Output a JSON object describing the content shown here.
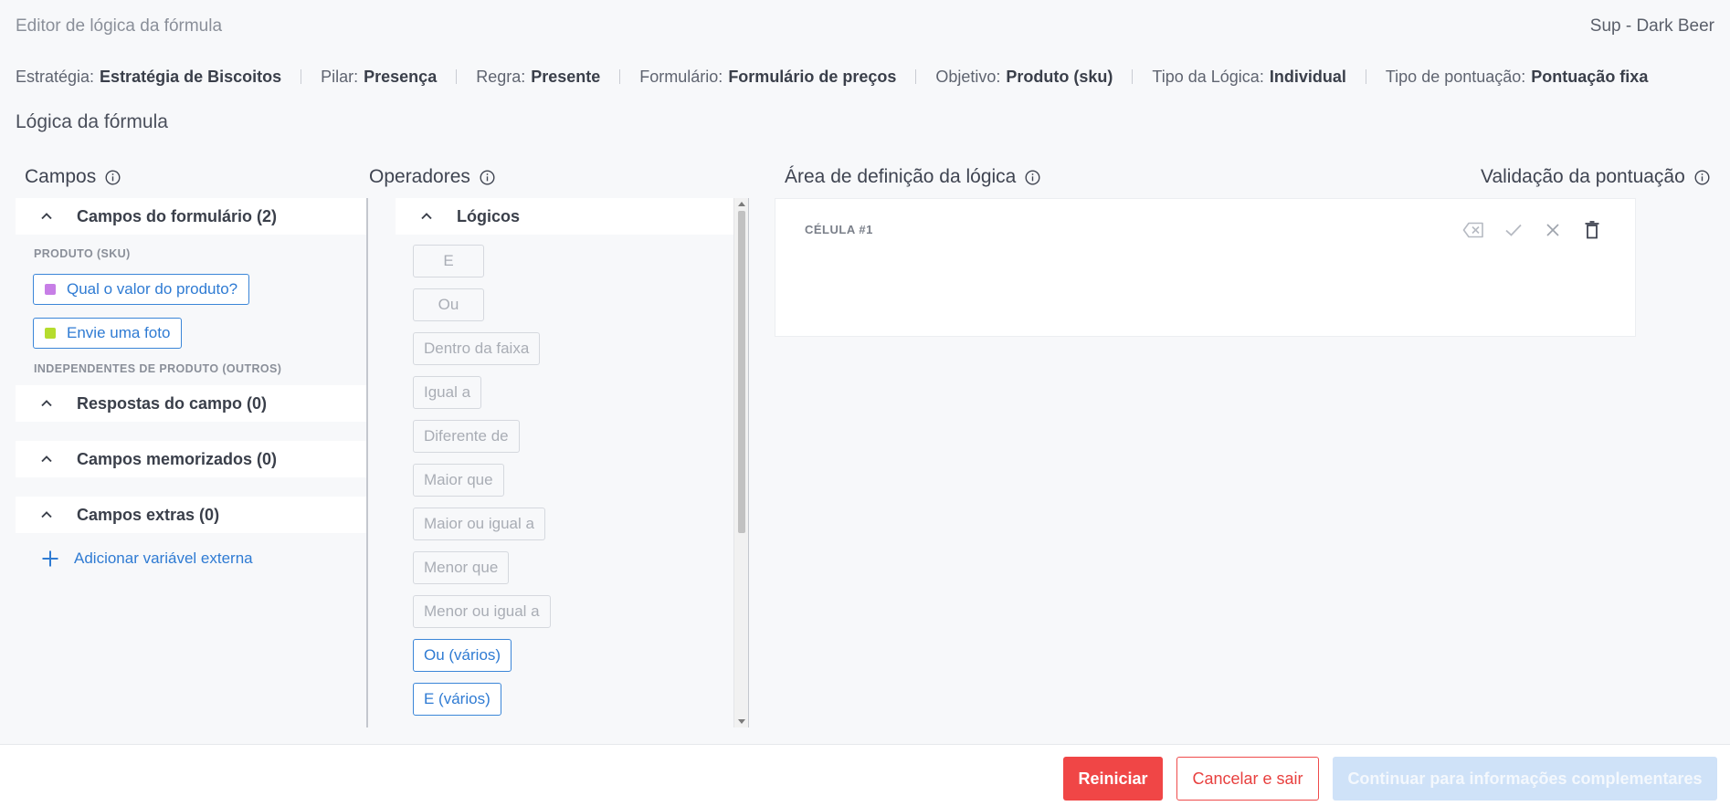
{
  "header": {
    "title": "Editor de lógica da fórmula",
    "user": "Sup - Dark Beer"
  },
  "meta": [
    {
      "label": "Estratégia:",
      "value": "Estratégia de Biscoitos"
    },
    {
      "label": "Pilar:",
      "value": "Presença"
    },
    {
      "label": "Regra:",
      "value": "Presente"
    },
    {
      "label": "Formulário:",
      "value": "Formulário de preços"
    },
    {
      "label": "Objetivo:",
      "value": "Produto (sku)"
    },
    {
      "label": "Tipo da Lógica:",
      "value": "Individual"
    },
    {
      "label": "Tipo de pontuação:",
      "value": "Pontuação fixa"
    }
  ],
  "section_title": "Lógica da fórmula",
  "columns": {
    "campos": "Campos",
    "operadores": "Operadores",
    "logic_area": "Área de definição da lógica",
    "validation": "Validação da pontuação"
  },
  "campos": {
    "groups": [
      {
        "label": "Campos do formulário (2)"
      },
      {
        "label": "Respostas do campo (0)"
      },
      {
        "label": "Campos memorizados (0)"
      },
      {
        "label": "Campos extras (0)"
      }
    ],
    "produto_label": "PRODUTO (SKU)",
    "independentes_label": "INDEPENDENTES DE PRODUTO (OUTROS)",
    "fields": [
      {
        "label": "Qual o valor do produto?",
        "color": "#c77ee6"
      },
      {
        "label": "Envie uma foto",
        "color": "#b5dc2e"
      }
    ],
    "add_external": "Adicionar variável externa"
  },
  "operadores": {
    "group": "Lógicos",
    "items": [
      {
        "label": "E",
        "active": false
      },
      {
        "label": "Ou",
        "active": false
      },
      {
        "label": "Dentro da faixa",
        "active": false
      },
      {
        "label": "Igual a",
        "active": false
      },
      {
        "label": "Diferente de",
        "active": false
      },
      {
        "label": "Maior que",
        "active": false
      },
      {
        "label": "Maior ou igual a",
        "active": false
      },
      {
        "label": "Menor que",
        "active": false
      },
      {
        "label": "Menor ou igual a",
        "active": false
      },
      {
        "label": "Ou (vários)",
        "active": true
      },
      {
        "label": "E (vários)",
        "active": true
      }
    ]
  },
  "logic": {
    "cell_label": "CÉLULA #1"
  },
  "footer": {
    "reset": "Reiniciar",
    "cancel": "Cancelar e sair",
    "continue": "Continuar para informações complementares"
  },
  "colors": {
    "primary": "#2f7bd3",
    "danger": "#f04646",
    "disabled": "#cfe2f8"
  }
}
